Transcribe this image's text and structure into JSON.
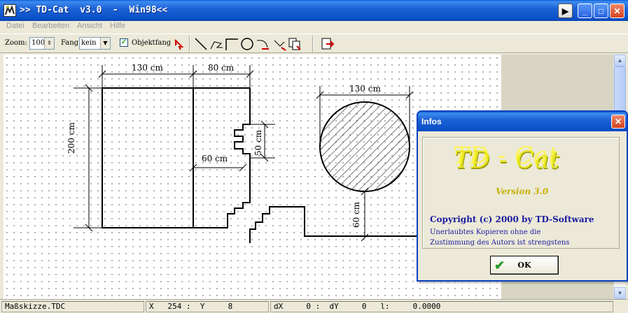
{
  "window": {
    "title": ">> TD-Cat  v3.0  -  Win98<<",
    "controls": {
      "arrow": "▶",
      "minimize": "_",
      "maximize": "□",
      "close": "✕"
    }
  },
  "menu": {
    "items": [
      {
        "label": "Datei"
      },
      {
        "label": "Bearbeiten"
      },
      {
        "label": "Ansicht"
      },
      {
        "label": "Hilfe"
      }
    ]
  },
  "toolbar": {
    "zoom_label": "Zoom:",
    "zoom_value": "100",
    "fang_label": "Fang:",
    "fang_value": "kein",
    "objektfang_label": "Objektfang",
    "objektfang_checked": true
  },
  "drawing": {
    "dims": {
      "top_left": "130 cm",
      "top_right": "80 cm",
      "left": "200 cm",
      "inner": "60 cm",
      "step": "50 cm",
      "circle_top": "130 cm",
      "circle_down": "60 cm"
    }
  },
  "statusbar": {
    "file": "Maßskizze.TDC",
    "coords": "X   254 :  Y     8",
    "deltas": "dX     0 :  dY     0   l:     0.0000"
  },
  "dialog": {
    "title": "Infos",
    "close": "✕",
    "logo": "TD - Cat",
    "version": "Version 3.0",
    "copyright": "Copyright (c) 2000 by TD-Software",
    "notice_line1": "Unerlaubtes Kopieren ohne die",
    "notice_line2": "Zustimmung des Autors ist strengstens",
    "ok_label": "OK",
    "ok_icon": "✔"
  },
  "colors": {
    "titlebar": "#0a4fc8",
    "accent_text": "#1a1aa0",
    "logo": "#e8e820"
  }
}
